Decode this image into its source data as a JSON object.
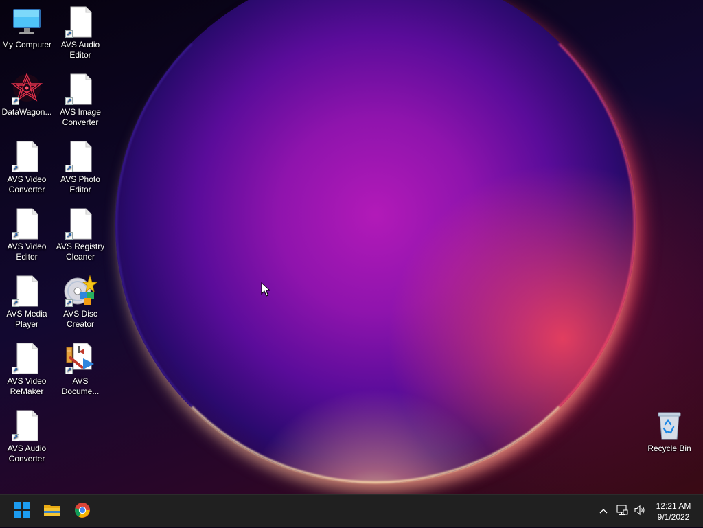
{
  "desktop": {
    "icons": [
      {
        "label": "My Computer",
        "icon": "monitor-icon"
      },
      {
        "label": "AVS Audio\nEditor",
        "icon": "document-icon"
      },
      {
        "label": "DataWagon...",
        "icon": "datawagon-icon"
      },
      {
        "label": "AVS Image\nConverter",
        "icon": "document-icon"
      },
      {
        "label": "AVS Video\nConverter",
        "icon": "document-icon"
      },
      {
        "label": "AVS Photo\nEditor",
        "icon": "document-icon"
      },
      {
        "label": "AVS Video\nEditor",
        "icon": "document-icon"
      },
      {
        "label": "AVS Registry\nCleaner",
        "icon": "document-icon"
      },
      {
        "label": "AVS Media\nPlayer",
        "icon": "document-icon"
      },
      {
        "label": "AVS Disc\nCreator",
        "icon": "disc-icon"
      },
      {
        "label": "AVS Video\nReMaker",
        "icon": "document-icon"
      },
      {
        "label": "AVS\nDocume...",
        "icon": "document-converter-icon"
      },
      {
        "label": "AVS Audio\nConverter",
        "icon": "document-icon"
      },
      {
        "label": "Recycle Bin",
        "icon": "recycle-bin-icon"
      }
    ]
  },
  "taskbar": {
    "apps": [
      {
        "name": "Start",
        "icon": "windows-start-icon"
      },
      {
        "name": "File Explorer",
        "icon": "folder-icon"
      },
      {
        "name": "Google Chrome",
        "icon": "chrome-icon"
      }
    ],
    "tray": {
      "icons": [
        "chevron-up-icon",
        "network-icon",
        "volume-icon"
      ]
    },
    "clock": {
      "time": "12:21 AM",
      "date": "9/1/2022"
    }
  },
  "colors": {
    "taskbar": "#202020",
    "start_blue": "#1c9cf0",
    "folder_yellow": "#f4c430"
  }
}
